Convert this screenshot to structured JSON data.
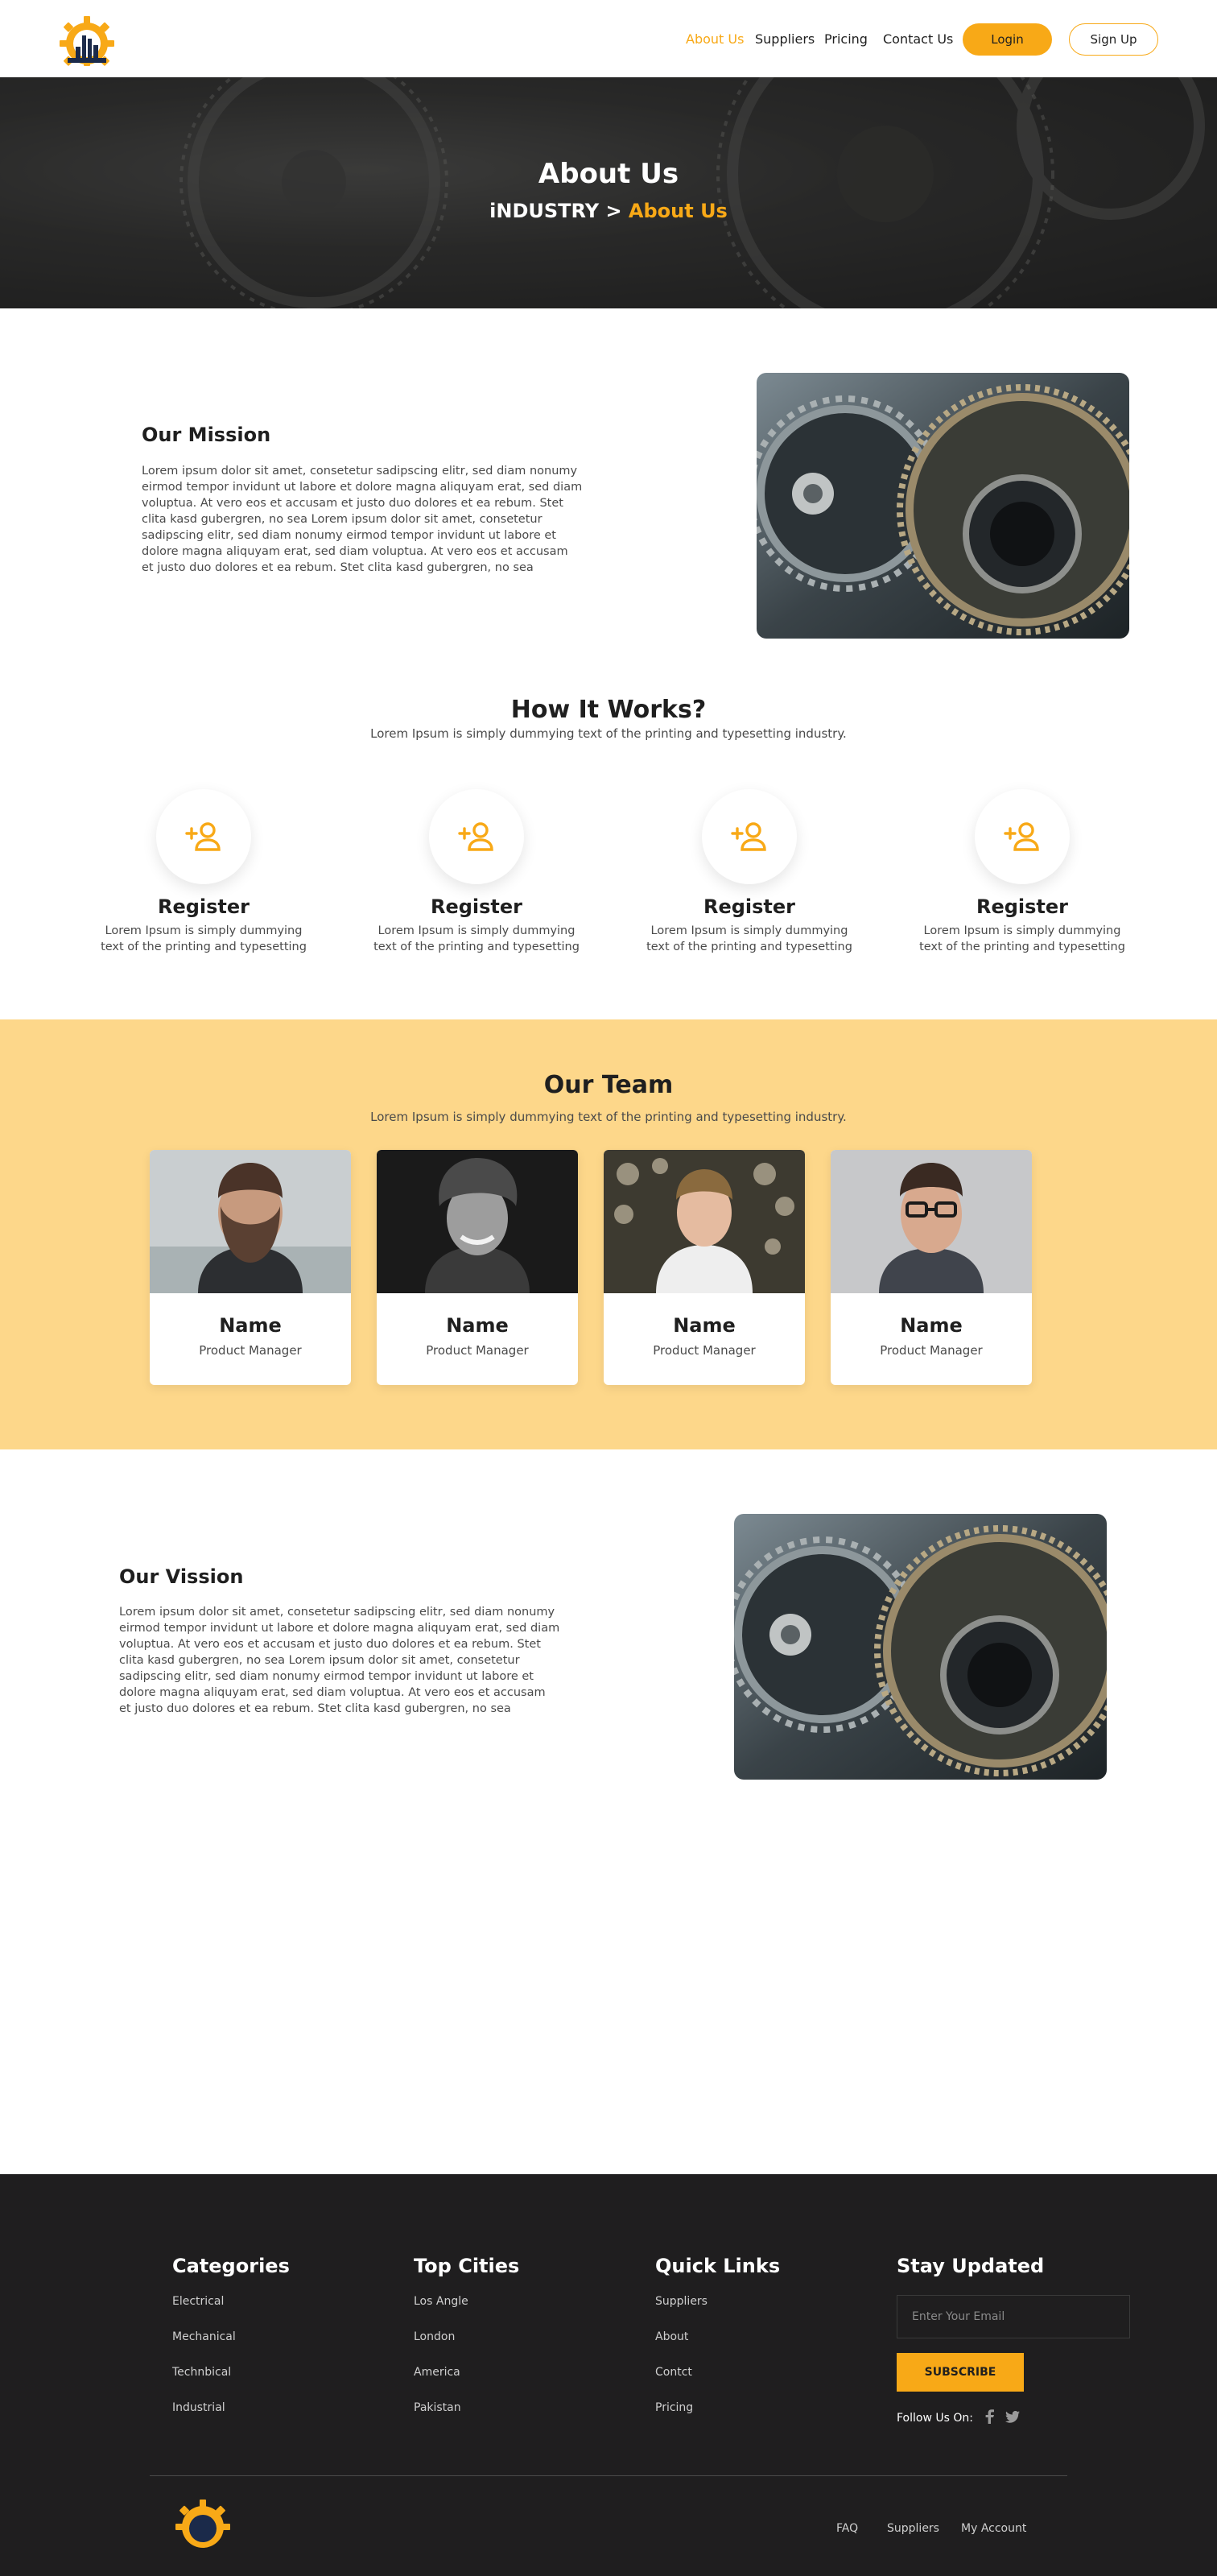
{
  "header": {
    "nav": [
      "About Us",
      "Suppliers",
      "Pricing",
      "Contact Us"
    ],
    "login": "Login",
    "signup": "Sign Up",
    "accent": "#f8a917"
  },
  "hero": {
    "title": "About Us",
    "crumb_root": "iNDUSTRY",
    "crumb_sep": ">",
    "crumb_current": "About Us"
  },
  "mission": {
    "title": "Our Mission",
    "text": "Lorem ipsum dolor sit amet, consetetur sadipscing elitr, sed diam nonumy eirmod tempor invidunt ut labore et dolore magna aliquyam erat, sed diam voluptua. At vero eos et accusam et justo duo dolores et ea rebum. Stet clita kasd gubergren, no sea Lorem ipsum dolor sit amet, consetetur sadipscing elitr, sed diam nonumy eirmod tempor invidunt ut labore et dolore magna aliquyam erat, sed diam voluptua. At vero eos et accusam et justo duo dolores et ea rebum. Stet clita kasd gubergren, no sea"
  },
  "how": {
    "title": "How It Works?",
    "subtitle": "Lorem Ipsum is simply dummying text of the printing and typesetting industry.",
    "steps": [
      {
        "title": "Register",
        "text": "Lorem Ipsum is simply dummying text of the printing and typesetting",
        "icon": "add-user-icon"
      },
      {
        "title": "Register",
        "text": "Lorem Ipsum is simply dummying text of the printing and typesetting",
        "icon": "add-user-icon"
      },
      {
        "title": "Register",
        "text": "Lorem Ipsum is simply dummying text of the printing and typesetting",
        "icon": "add-user-icon"
      },
      {
        "title": "Register",
        "text": "Lorem Ipsum is simply dummying text of the printing and typesetting",
        "icon": "add-user-icon"
      }
    ]
  },
  "team": {
    "title": "Our Team",
    "subtitle": "Lorem Ipsum is simply dummying text of the printing and typesetting industry.",
    "members": [
      {
        "name": "Name",
        "role": "Product Manager"
      },
      {
        "name": "Name",
        "role": "Product Manager"
      },
      {
        "name": "Name",
        "role": "Product Manager"
      },
      {
        "name": "Name",
        "role": "Product Manager"
      }
    ]
  },
  "vision": {
    "title": "Our Vission",
    "text": "Lorem ipsum dolor sit amet, consetetur sadipscing elitr, sed diam nonumy eirmod tempor invidunt ut labore et dolore magna aliquyam erat, sed diam voluptua. At vero eos et accusam et justo duo dolores et ea rebum. Stet clita kasd gubergren, no sea Lorem ipsum dolor sit amet, consetetur sadipscing elitr, sed diam nonumy eirmod tempor invidunt ut labore et dolore magna aliquyam erat, sed diam voluptua. At vero eos et accusam et justo duo dolores et ea rebum. Stet clita kasd gubergren, no sea"
  },
  "footer": {
    "categories": {
      "title": "Categories",
      "items": [
        "Electrical",
        "Mechanical",
        "Technbical",
        "Industrial"
      ]
    },
    "cities": {
      "title": "Top Cities",
      "items": [
        "Los Angle",
        "London",
        "America",
        "Pakistan"
      ]
    },
    "links": {
      "title": "Quick Links",
      "items": [
        "Suppliers",
        "About",
        "Contct",
        "Pricing"
      ]
    },
    "updates": {
      "title": "Stay Updated",
      "email_placeholder": "Enter Your Email",
      "subscribe": "SUBSCRIBE",
      "follow": "Follow Us On:",
      "social_icons": [
        "facebook-icon",
        "twitter-icon"
      ]
    },
    "bottom_links": [
      "FAQ",
      "Suppliers",
      "My Account"
    ],
    "bg": "#1f1e1f"
  }
}
